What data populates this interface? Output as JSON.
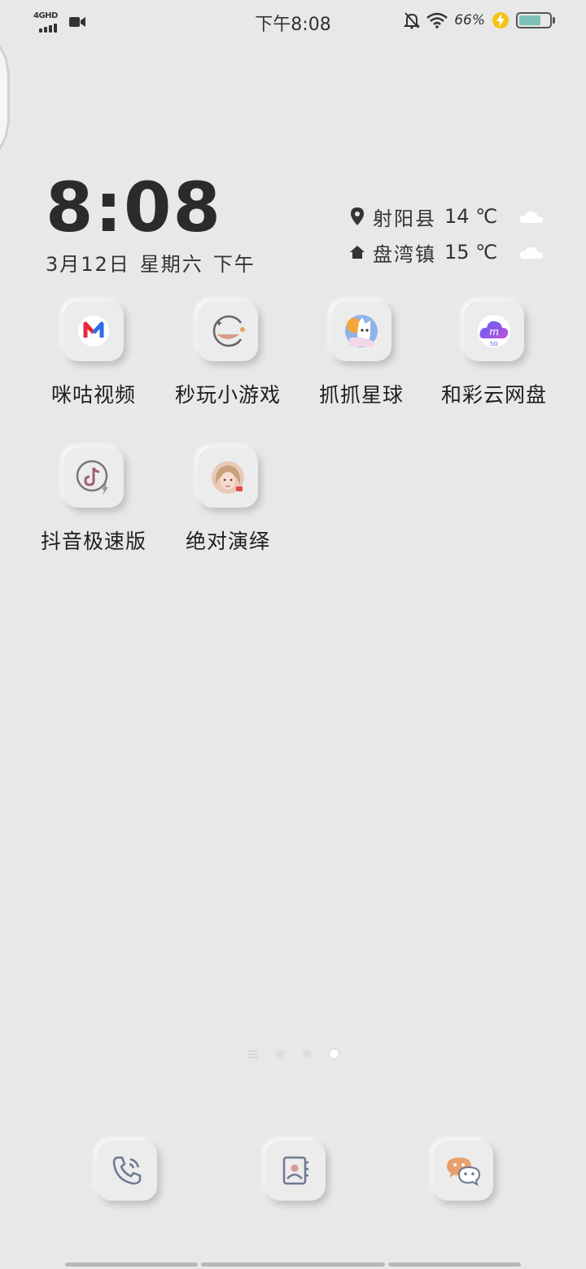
{
  "status_bar": {
    "network_label": "4GHD",
    "time": "下午8:08",
    "battery_percent": "66%",
    "battery_level": 0.66,
    "icons": [
      "signal-icon",
      "video-icon",
      "mute-icon",
      "wifi-icon",
      "charging-icon",
      "battery-icon"
    ]
  },
  "clock_widget": {
    "time": "8:08",
    "date": "3月12日",
    "weekday": "星期六",
    "period": "下午"
  },
  "weather": [
    {
      "place": "射阳县",
      "temp": "14 ℃",
      "icon": "location-pin-icon",
      "weather_icon": "cloud-icon"
    },
    {
      "place": "盘湾镇",
      "temp": "15 ℃",
      "icon": "home-icon",
      "weather_icon": "cloud-icon"
    }
  ],
  "apps": [
    {
      "label": "咪咕视频",
      "icon": "migu-video-icon"
    },
    {
      "label": "秒玩小游戏",
      "icon": "mini-games-icon"
    },
    {
      "label": "抓抓星球",
      "icon": "zhuazhua-planet-icon"
    },
    {
      "label": "和彩云网盘",
      "icon": "hecaiyun-cloud-icon"
    },
    {
      "label": "抖音极速版",
      "icon": "douyin-lite-icon"
    },
    {
      "label": "绝对演绎",
      "icon": "juedui-yanyi-icon"
    }
  ],
  "page_indicator": {
    "pages": 3,
    "current": 3
  },
  "dock": [
    {
      "name": "phone",
      "icon": "phone-icon"
    },
    {
      "name": "contacts",
      "icon": "contacts-icon"
    },
    {
      "name": "wechat",
      "icon": "wechat-icon"
    }
  ],
  "colors": {
    "background": "#e8e8e8",
    "battery_fill": "#7cc0b8",
    "charging": "#f2c316",
    "migu_red": "#e8293b",
    "migu_blue": "#2d6de6"
  }
}
